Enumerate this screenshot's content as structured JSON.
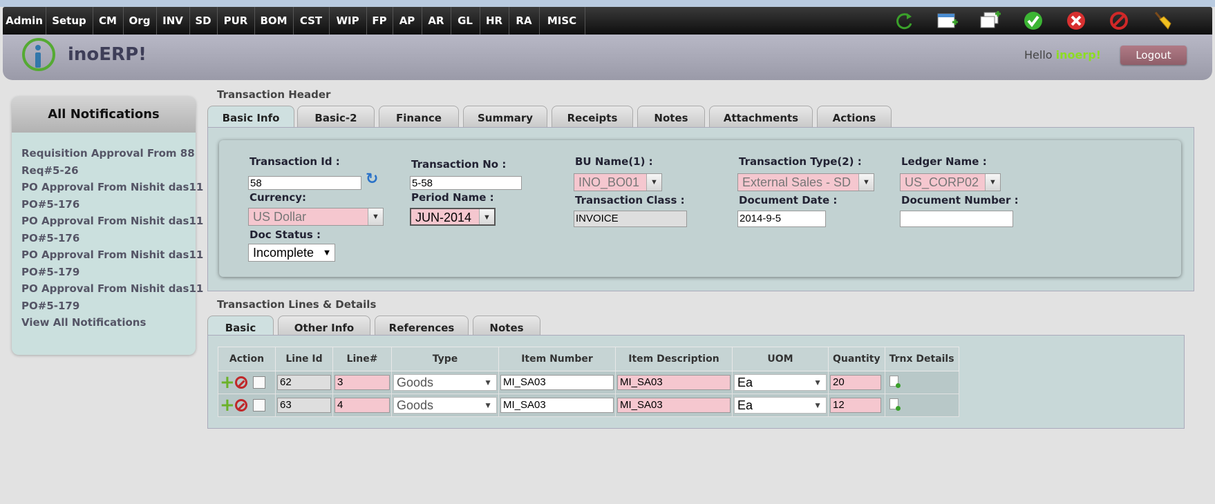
{
  "menu": [
    "Admin",
    "Setup",
    "CM",
    "Org",
    "INV",
    "SD",
    "PUR",
    "BOM",
    "CST",
    "WIP",
    "FP",
    "AP",
    "AR",
    "GL",
    "HR",
    "RA",
    "MISC"
  ],
  "toolbar_icons": [
    "refresh-icon",
    "new-window-icon",
    "copy-window-icon",
    "save-check-icon",
    "delete-x-icon",
    "cancel-icon",
    "clear-broom-icon"
  ],
  "brand": {
    "name": "inoERP!"
  },
  "user": {
    "hello": "Hello ",
    "name": "inoerp!",
    "logout": "Logout"
  },
  "notifications": {
    "title": "All Notifications",
    "lines": [
      "Requisition Approval From 88",
      "Req#5-26",
      "PO Approval From Nishit das11",
      "PO#5-176",
      "PO Approval From Nishit das11",
      "PO#5-176",
      "PO Approval From Nishit das11",
      "PO#5-179",
      "PO Approval From Nishit das11",
      "PO#5-179"
    ],
    "view_all": "View All Notifications"
  },
  "header": {
    "title": "Transaction Header",
    "tabs": [
      "Basic Info",
      "Basic-2",
      "Finance",
      "Summary",
      "Receipts",
      "Notes",
      "Attachments",
      "Actions"
    ],
    "fields": {
      "transaction_id": {
        "label": "Transaction Id :",
        "value": "58"
      },
      "transaction_no": {
        "label": "Transaction No :",
        "value": "5-58"
      },
      "bu_name": {
        "label": "BU Name(1) :",
        "value": "INO_BO01"
      },
      "transaction_type": {
        "label": "Transaction Type(2) :",
        "value": "External Sales - SD"
      },
      "ledger_name": {
        "label": "Ledger Name :",
        "value": "US_CORP02"
      },
      "currency": {
        "label": "Currency:",
        "value": "US Dollar"
      },
      "period_name": {
        "label": "Period Name :",
        "value": "JUN-2014"
      },
      "transaction_class": {
        "label": "Transaction Class :",
        "value": "INVOICE"
      },
      "document_date": {
        "label": "Document Date :",
        "value": "2014-9-5"
      },
      "document_number": {
        "label": "Document Number :",
        "value": ""
      },
      "doc_status": {
        "label": "Doc Status :",
        "value": "Incomplete"
      }
    }
  },
  "lines": {
    "title": "Transaction Lines & Details",
    "tabs": [
      "Basic",
      "Other Info",
      "References",
      "Notes"
    ],
    "columns": [
      "Action",
      "Line Id",
      "Line#",
      "Type",
      "Item Number",
      "Item Description",
      "UOM",
      "Quantity",
      "Trnx Details"
    ],
    "rows": [
      {
        "line_id": "62",
        "line_no": "3",
        "type": "Goods",
        "item_number": "MI_SA03",
        "item_description": "MI_SA03",
        "uom": "Ea",
        "quantity": "20"
      },
      {
        "line_id": "63",
        "line_no": "4",
        "type": "Goods",
        "item_number": "MI_SA03",
        "item_description": "MI_SA03",
        "uom": "Ea",
        "quantity": "12"
      }
    ]
  }
}
